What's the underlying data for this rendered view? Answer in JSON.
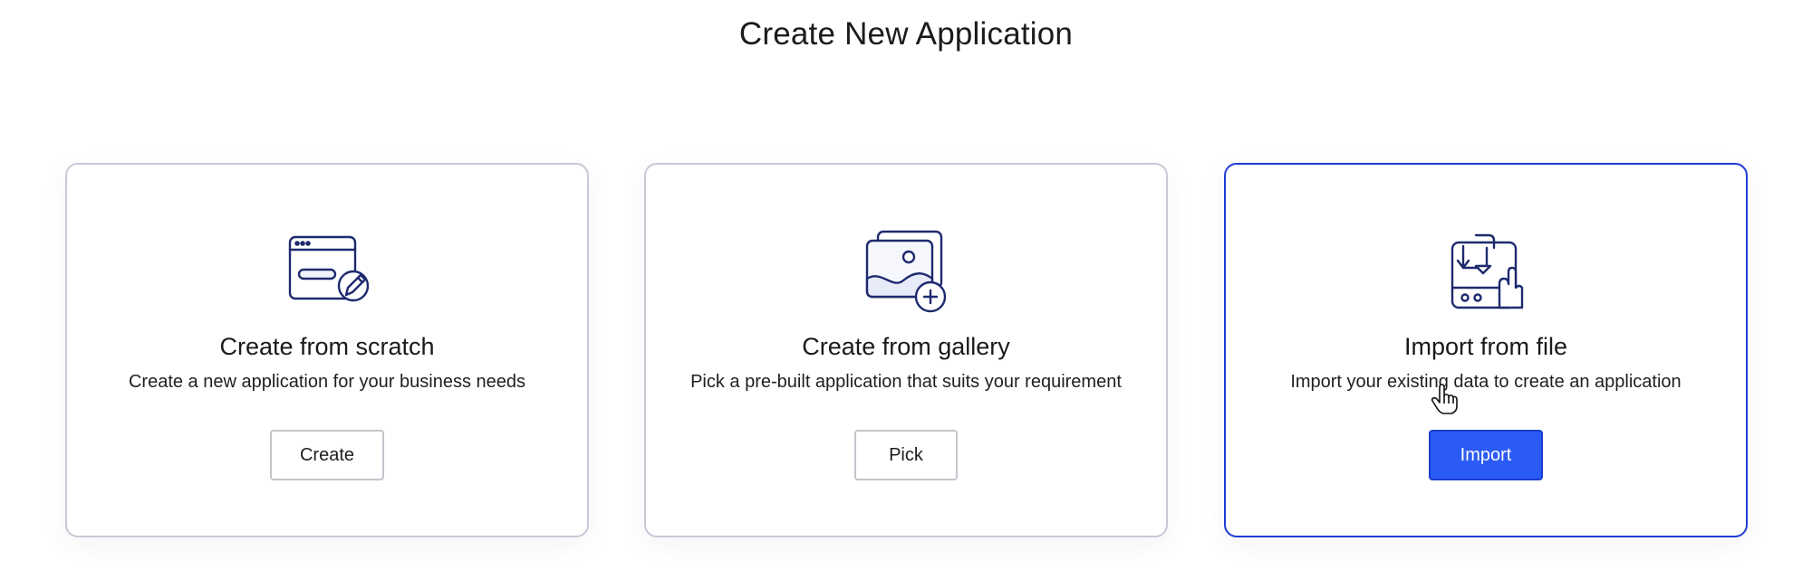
{
  "page": {
    "title": "Create New Application"
  },
  "cards": [
    {
      "title": "Create from scratch",
      "description": "Create a new application for your business needs",
      "button_label": "Create",
      "icon": "browser-window-pencil-icon"
    },
    {
      "title": "Create from gallery",
      "description": "Pick a pre-built application that suits your requirement",
      "button_label": "Pick",
      "icon": "image-gallery-add-icon"
    },
    {
      "title": "Import from file",
      "description": "Import your existing data to create an application",
      "button_label": "Import",
      "icon": "import-hand-icon"
    }
  ],
  "colors": {
    "accent": "#2b5bf5",
    "selected_border": "#1f3cd6",
    "card_border": "#c8c9d6",
    "icon_stroke": "#1e2a6e"
  }
}
